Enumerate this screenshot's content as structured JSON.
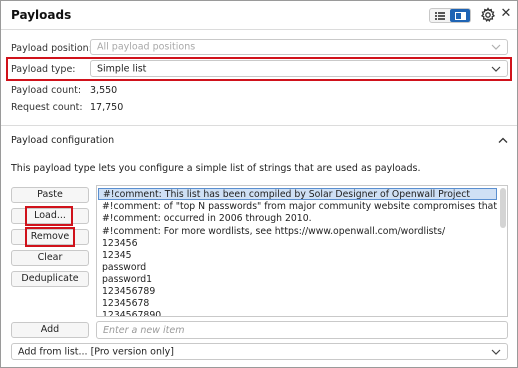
{
  "header": {
    "title": "Payloads"
  },
  "position": {
    "label": "Payload position:",
    "value": "All payload positions"
  },
  "type": {
    "label": "Payload type:",
    "value": "Simple list"
  },
  "stats": {
    "count_label": "Payload count:",
    "count_value": "3,550",
    "request_label": "Request count:",
    "request_value": "17,750"
  },
  "config": {
    "section_title": "Payload configuration",
    "description": "This payload type lets you configure a simple list of strings that are used as payloads."
  },
  "buttons": {
    "paste": "Paste",
    "load": "Load...",
    "remove": "Remove",
    "clear": "Clear",
    "deduplicate": "Deduplicate",
    "add": "Add"
  },
  "list": {
    "items": [
      "#!comment: This list has been compiled by Solar Designer of Openwall Project",
      "#!comment: of \"top N passwords\" from major community website compromises that",
      "#!comment: occurred in 2006 through 2010.",
      "#!comment: For more wordlists, see https://www.openwall.com/wordlists/",
      "123456",
      "12345",
      "password",
      "password1",
      "123456789",
      "12345678",
      "1234567890"
    ]
  },
  "new_item": {
    "placeholder": "Enter a new item",
    "value": ""
  },
  "add_from_list": {
    "value": "Add from list... [Pro version only]"
  },
  "colors": {
    "accent": "#1f64b4",
    "highlight_box": "#d0121b",
    "selection": "#cfe0f5"
  }
}
